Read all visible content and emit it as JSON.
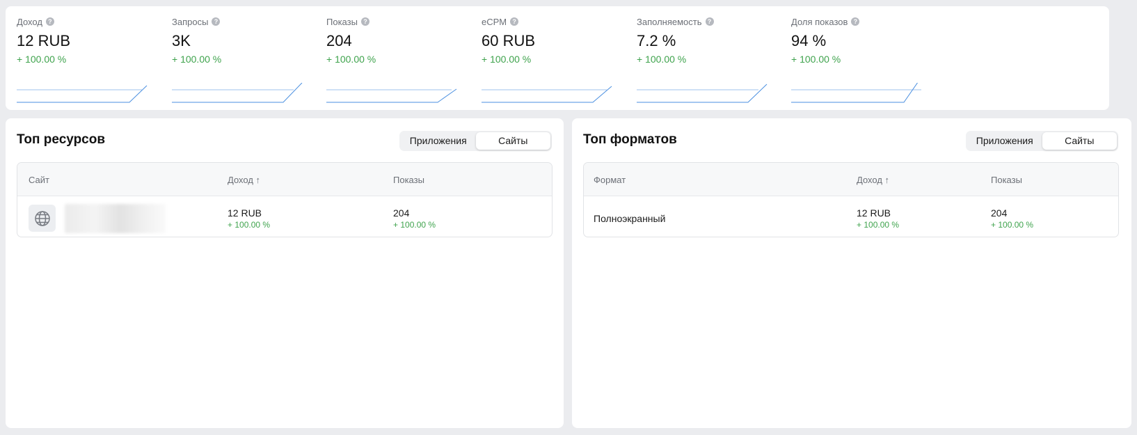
{
  "metrics": [
    {
      "label": "Доход",
      "value": "12 RUB",
      "delta": "+ 100.00 %"
    },
    {
      "label": "Запросы",
      "value": "3K",
      "delta": "+ 100.00 %"
    },
    {
      "label": "Показы",
      "value": "204",
      "delta": "+ 100.00 %"
    },
    {
      "label": "eCPM",
      "value": "60 RUB",
      "delta": "+ 100.00 %"
    },
    {
      "label": "Заполняемость",
      "value": "7.2 %",
      "delta": "+ 100.00 %"
    },
    {
      "label": "Доля показов",
      "value": "94 %",
      "delta": "+ 100.00 %"
    }
  ],
  "top_resources": {
    "title": "Топ ресурсов",
    "toggle": [
      "Приложения",
      "Сайты"
    ],
    "active_toggle": "Сайты",
    "columns": [
      "Сайт",
      "Доход ↑",
      "Показы"
    ],
    "rows": [
      {
        "income": "12 RUB",
        "income_delta": "+ 100.00 %",
        "shows": "204",
        "shows_delta": "+ 100.00 %"
      }
    ]
  },
  "top_formats": {
    "title": "Топ форматов",
    "toggle": [
      "Приложения",
      "Сайты"
    ],
    "active_toggle": "Сайты",
    "columns": [
      "Формат",
      "Доход ↑",
      "Показы"
    ],
    "rows": [
      {
        "format": "Полноэкранный",
        "income": "12 RUB",
        "income_delta": "+ 100.00 %",
        "shows": "204",
        "shows_delta": "+ 100.00 %"
      }
    ]
  },
  "colors": {
    "positive": "#3fa34d",
    "sparkline": "#4a8fe0"
  },
  "icons": {
    "help": "question-circle-icon",
    "site": "globe-icon"
  }
}
